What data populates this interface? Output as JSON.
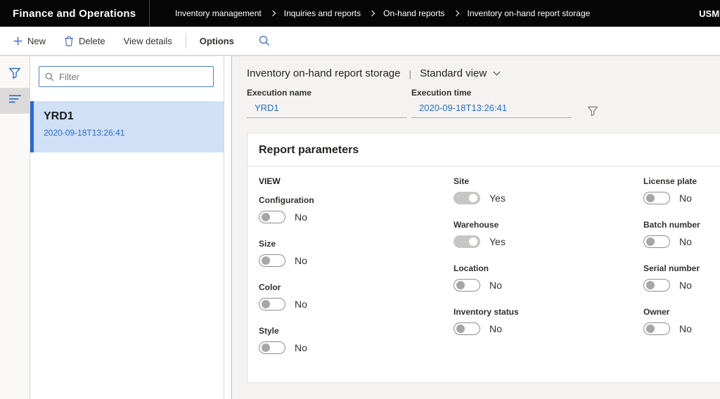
{
  "colors": {
    "topbar_bg": "#050505",
    "accent_blue": "#2b6bd0",
    "command_icon_blue": "#4f6bd5",
    "filter_border": "#4c82c8",
    "selected_row_bg": "#cfe0f7",
    "selected_row_bar": "#2c67ce",
    "main_bg": "#f4f3f2",
    "toggle_on_bg": "#c8c6c4",
    "toggle_off_border": "#908e8c"
  },
  "icons": {
    "new": "plus-icon",
    "delete": "trash-icon",
    "find": "search-icon",
    "filter_pane": "funnel-icon",
    "show_list": "list-lines-icon",
    "breadcrumb_separator": "chevron-right-icon",
    "view_dropdown": "chevron-down-icon",
    "grid_filter": "funnel-icon"
  },
  "top_bar": {
    "brand": "Finance and Operations",
    "breadcrumb": [
      "Inventory management",
      "Inquiries and reports",
      "On-hand reports",
      "Inventory on-hand report storage"
    ],
    "company": "USMF"
  },
  "action_bar": {
    "new": "New",
    "delete": "Delete",
    "view_details": "View details",
    "options": "Options"
  },
  "left_panel": {
    "filter_placeholder": "Filter",
    "records": [
      {
        "name": "YRD1",
        "timestamp": "2020-09-18T13:26:41",
        "selected": true
      }
    ]
  },
  "main": {
    "title": "Inventory on-hand report storage",
    "title_separator": "|",
    "view_label": "Standard view",
    "fields": [
      {
        "label": "Execution name",
        "value": "YRD1"
      },
      {
        "label": "Execution time",
        "value": "2020-09-18T13:26:41"
      }
    ],
    "report_parameters": {
      "title": "Report parameters",
      "columns": [
        {
          "header": "VIEW",
          "fields": [
            {
              "label": "Configuration",
              "value": "No",
              "on": false
            },
            {
              "label": "Size",
              "value": "No",
              "on": false
            },
            {
              "label": "Color",
              "value": "No",
              "on": false
            },
            {
              "label": "Style",
              "value": "No",
              "on": false
            }
          ]
        },
        {
          "header": "",
          "fields": [
            {
              "label": "Site",
              "value": "Yes",
              "on": true
            },
            {
              "label": "Warehouse",
              "value": "Yes",
              "on": true
            },
            {
              "label": "Location",
              "value": "No",
              "on": false
            },
            {
              "label": "Inventory status",
              "value": "No",
              "on": false
            }
          ]
        },
        {
          "header": "",
          "fields": [
            {
              "label": "License plate",
              "value": "No",
              "on": false
            },
            {
              "label": "Batch number",
              "value": "No",
              "on": false
            },
            {
              "label": "Serial number",
              "value": "No",
              "on": false
            },
            {
              "label": "Owner",
              "value": "No",
              "on": false
            }
          ]
        }
      ]
    }
  }
}
